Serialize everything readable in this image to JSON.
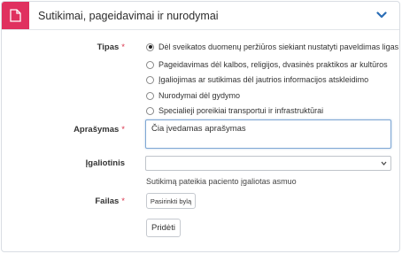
{
  "panel": {
    "title": "Sutikimai, pageidavimai ir nurodymai",
    "header_icon": "document-icon",
    "toggle_icon": "chevron-down-icon",
    "accent_color": "#e0315f",
    "chevron_color": "#2a6db5"
  },
  "form": {
    "required_mark": "*",
    "tipas": {
      "label": "Tipas",
      "selected_index": 0,
      "options": [
        "Dėl sveikatos duomenų peržiūros siekiant nustatyti paveldimas ligas",
        "Pageidavimas dėl kalbos, religijos, dvasinės praktikos ar kultūros",
        "Įgaliojimas ar sutikimas dėl jautrios informacijos atskleidimo",
        "Nurodymai dėl gydymo",
        "Specialieji poreikiai transportui ir infrastruktūrai"
      ]
    },
    "aprasymas": {
      "label": "Aprašymas",
      "value": "Čia įvedamas aprašymas"
    },
    "igaliotinis": {
      "label": "Įgaliotinis",
      "value": "",
      "help": "Sutikimą pateikia paciento įgaliotas asmuo"
    },
    "failas": {
      "label": "Failas",
      "button_label": "Pasirinkti bylą"
    },
    "submit_label": "Pridėti"
  }
}
